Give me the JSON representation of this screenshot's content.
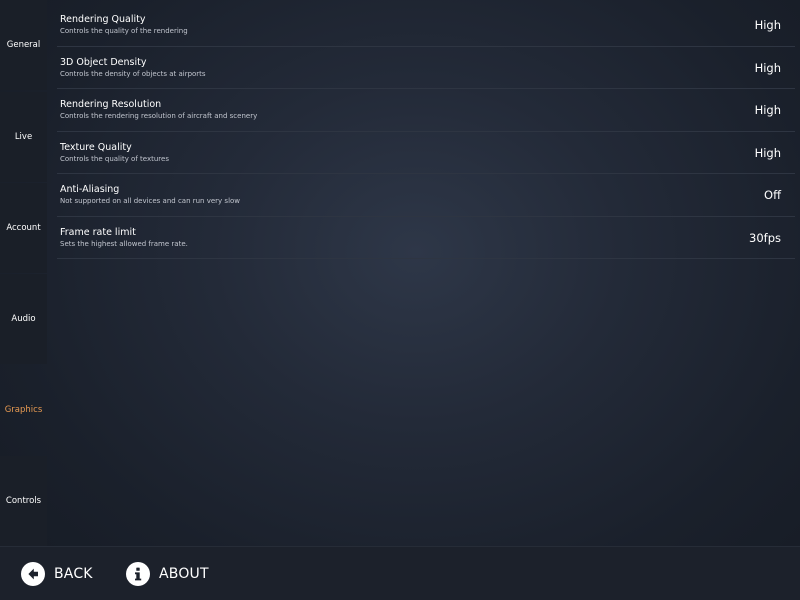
{
  "sidebar": {
    "items": [
      {
        "label": "General",
        "active": false
      },
      {
        "label": "Live",
        "active": false
      },
      {
        "label": "Account",
        "active": false
      },
      {
        "label": "Audio",
        "active": false
      },
      {
        "label": "Graphics",
        "active": true
      },
      {
        "label": "Controls",
        "active": false
      }
    ]
  },
  "settings": [
    {
      "title": "Rendering Quality",
      "description": "Controls the quality of the rendering",
      "value": "High"
    },
    {
      "title": "3D Object Density",
      "description": "Controls the density of objects at airports",
      "value": "High"
    },
    {
      "title": "Rendering Resolution",
      "description": "Controls the rendering resolution of aircraft and scenery",
      "value": "High"
    },
    {
      "title": "Texture Quality",
      "description": "Controls the quality of textures",
      "value": "High"
    },
    {
      "title": "Anti-Aliasing",
      "description": "Not supported on all devices and can run very slow",
      "value": "Off"
    },
    {
      "title": "Frame rate limit",
      "description": "Sets the highest allowed frame rate.",
      "value": "30fps"
    }
  ],
  "bottombar": {
    "back_label": "BACK",
    "about_label": "ABOUT",
    "back_icon": "arrow-left-circle-icon",
    "about_icon": "info-circle-icon"
  },
  "colors": {
    "accent": "#e79a52",
    "sidebar_bg": "#1a1f28",
    "text": "#ffffff"
  }
}
